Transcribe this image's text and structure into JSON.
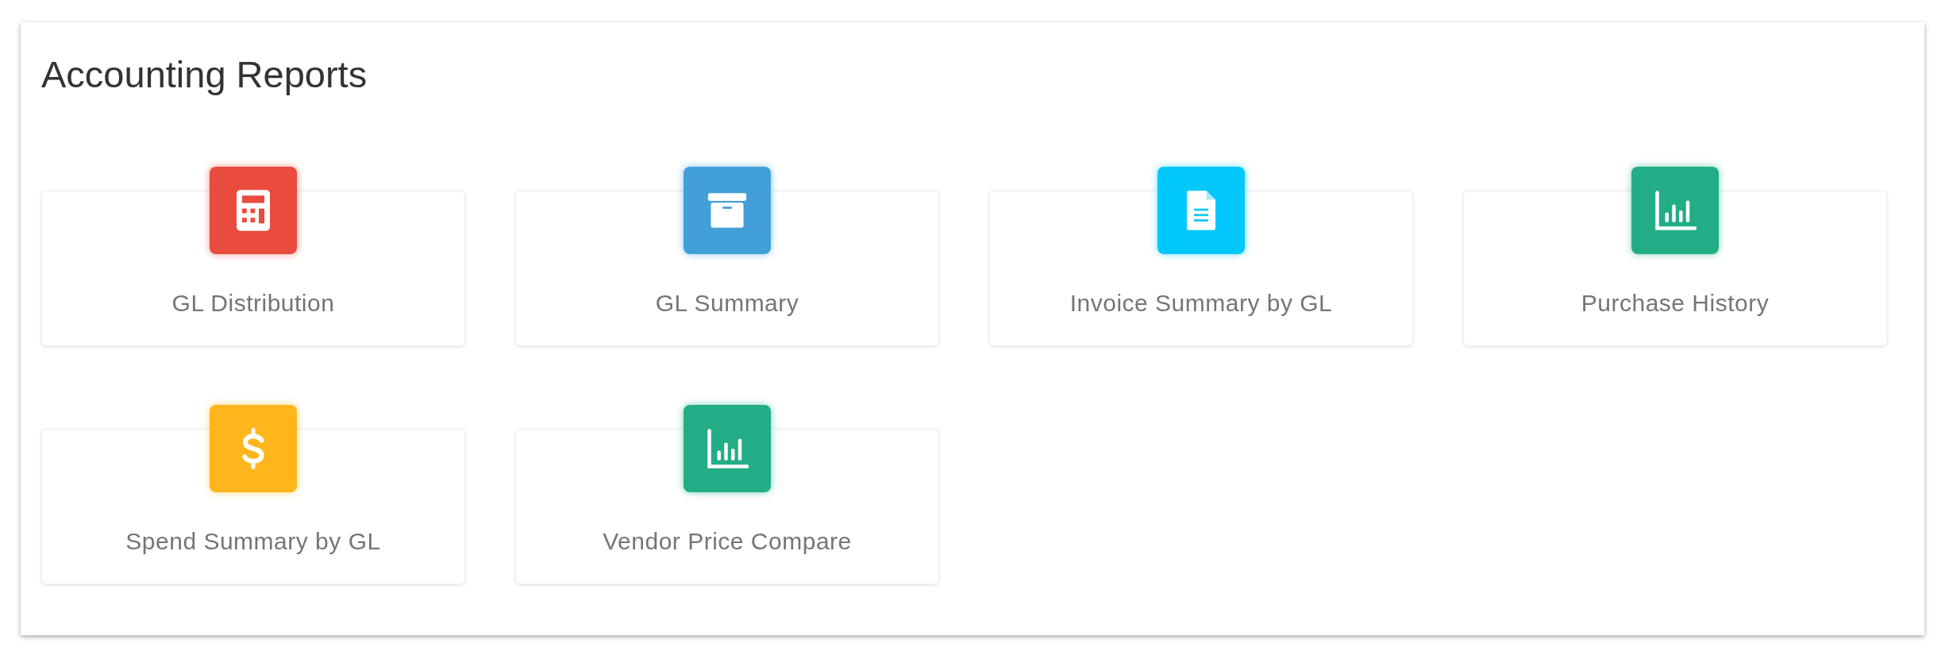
{
  "title": "Accounting Reports",
  "reports": [
    {
      "label": "GL Distribution",
      "kind": "calculator",
      "color": "#e94b3c"
    },
    {
      "label": "GL Summary",
      "kind": "archive",
      "color": "#439fd8"
    },
    {
      "label": "Invoice Summary by GL",
      "kind": "document",
      "color": "#00c8fa"
    },
    {
      "label": "Purchase History",
      "kind": "chart",
      "color": "#22ad87"
    },
    {
      "label": "Spend Summary by GL",
      "kind": "dollar",
      "color": "#ffb61c"
    },
    {
      "label": "Vendor Price Compare",
      "kind": "chart",
      "color": "#22ad87"
    }
  ]
}
